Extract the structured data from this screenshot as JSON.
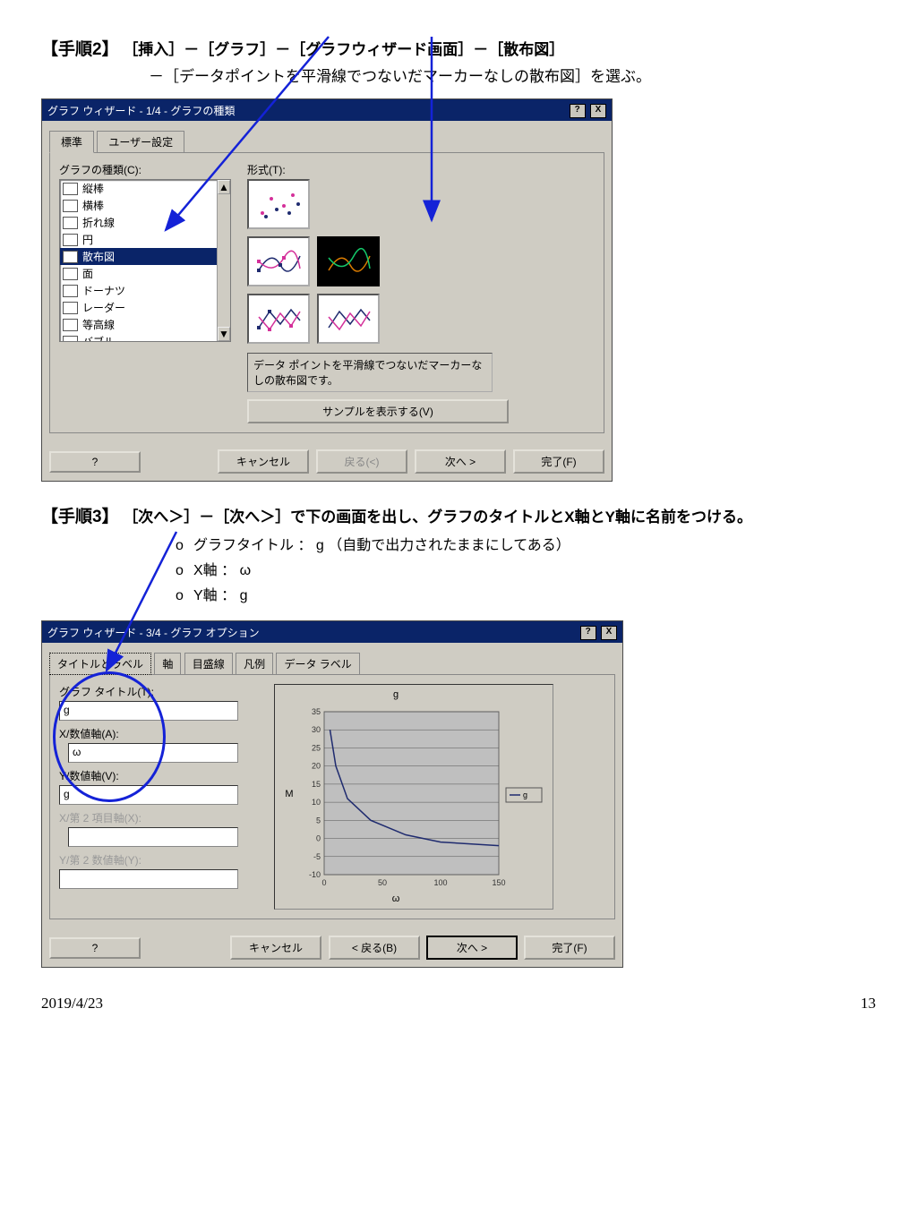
{
  "step2": {
    "label": "【手順2】",
    "line1": "［挿入］－［グラフ］－［グラフウィザード画面］－［散布図］",
    "line2": "－［データポイントを平滑線でつないだマーカーなしの散布図］を選ぶ。"
  },
  "dlg1": {
    "title": "グラフ ウィザード - 1/4 - グラフの種類",
    "tab_std": "標準",
    "tab_user": "ユーザー設定",
    "lbl_type": "グラフの種類(C):",
    "lbl_form": "形式(T):",
    "items": [
      "縦棒",
      "横棒",
      "折れ線",
      "円",
      "散布図",
      "面",
      "ドーナツ",
      "レーダー",
      "等高線",
      "バブル"
    ],
    "desc": "データ ポイントを平滑線でつないだマーカーなしの散布図です。",
    "btn_sample": "サンプルを表示する(V)",
    "btn_cancel": "キャンセル",
    "btn_back": "戻る(<)",
    "btn_next": "次へ >",
    "btn_finish": "完了(F)",
    "help": "?",
    "close": "X"
  },
  "step3": {
    "label": "【手順3】",
    "line1": "［次へ＞］－［次へ＞］で下の画面を出し、グラフのタイトルとX軸とY軸に名前をつける。",
    "b1": "グラフタイトル ：  g （自動で出力されたままにしてある）",
    "b2": "X軸 ：  ω",
    "b3": "Y軸 ：  g"
  },
  "dlg2": {
    "title": "グラフ ウィザード - 3/4 - グラフ オプション",
    "tabs": [
      "タイトルとラベル",
      "軸",
      "目盛線",
      "凡例",
      "データ ラベル"
    ],
    "lbl_title": "グラフ タイトル(T):",
    "val_title": "g",
    "lbl_x": "X/数値軸(A):",
    "val_x": "ω",
    "lbl_y": "Y/数値軸(V):",
    "val_y": "g",
    "lbl_x2": "X/第 2 項目軸(X):",
    "lbl_y2": "Y/第 2 数値軸(Y):",
    "btn_cancel": "キャンセル",
    "btn_back": "< 戻る(B)",
    "btn_next": "次へ >",
    "btn_finish": "完了(F)",
    "help": "?",
    "close": "X",
    "legend": "g"
  },
  "chart_data": {
    "type": "line",
    "title": "g",
    "xlabel": "ω",
    "ylabel": "M",
    "x": [
      0,
      50,
      100,
      150
    ],
    "ylim": [
      -10,
      35
    ],
    "yticks": [
      -10,
      -5,
      0,
      5,
      10,
      15,
      20,
      25,
      30,
      35
    ],
    "series": [
      {
        "name": "g",
        "x": [
          5,
          10,
          20,
          40,
          70,
          100,
          150
        ],
        "y": [
          30,
          20,
          11,
          5,
          1,
          -1,
          -2
        ]
      }
    ]
  },
  "footer": {
    "date": "2019/4/23",
    "page": "13"
  }
}
